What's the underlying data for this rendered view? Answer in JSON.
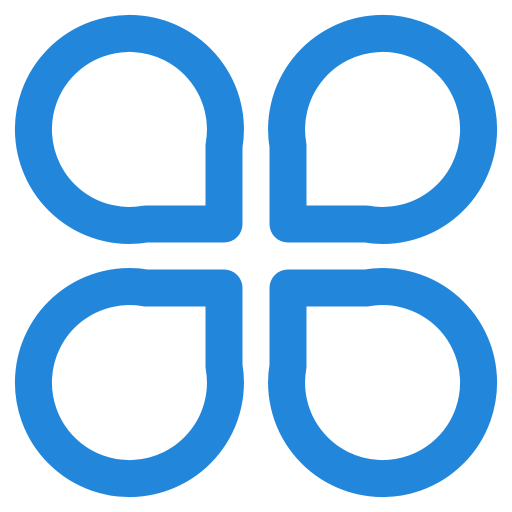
{
  "icon": {
    "name": "four-petal-clover-icon",
    "stroke_color": "#2286DB",
    "background_color": "#FFFFFF",
    "petals": [
      "top-left",
      "top-right",
      "bottom-left",
      "bottom-right"
    ]
  }
}
